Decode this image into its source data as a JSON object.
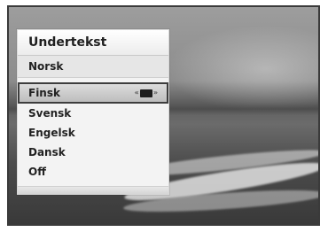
{
  "menu": {
    "title": "Undertekst",
    "current": "Norsk",
    "items": [
      {
        "label": "Finsk",
        "selected": true
      },
      {
        "label": "Svensk"
      },
      {
        "label": "Engelsk"
      },
      {
        "label": "Dansk"
      },
      {
        "label": "Off"
      }
    ],
    "selected_icon": "subtitle-icon",
    "selected_icon_left": "«",
    "selected_icon_right": "»"
  }
}
